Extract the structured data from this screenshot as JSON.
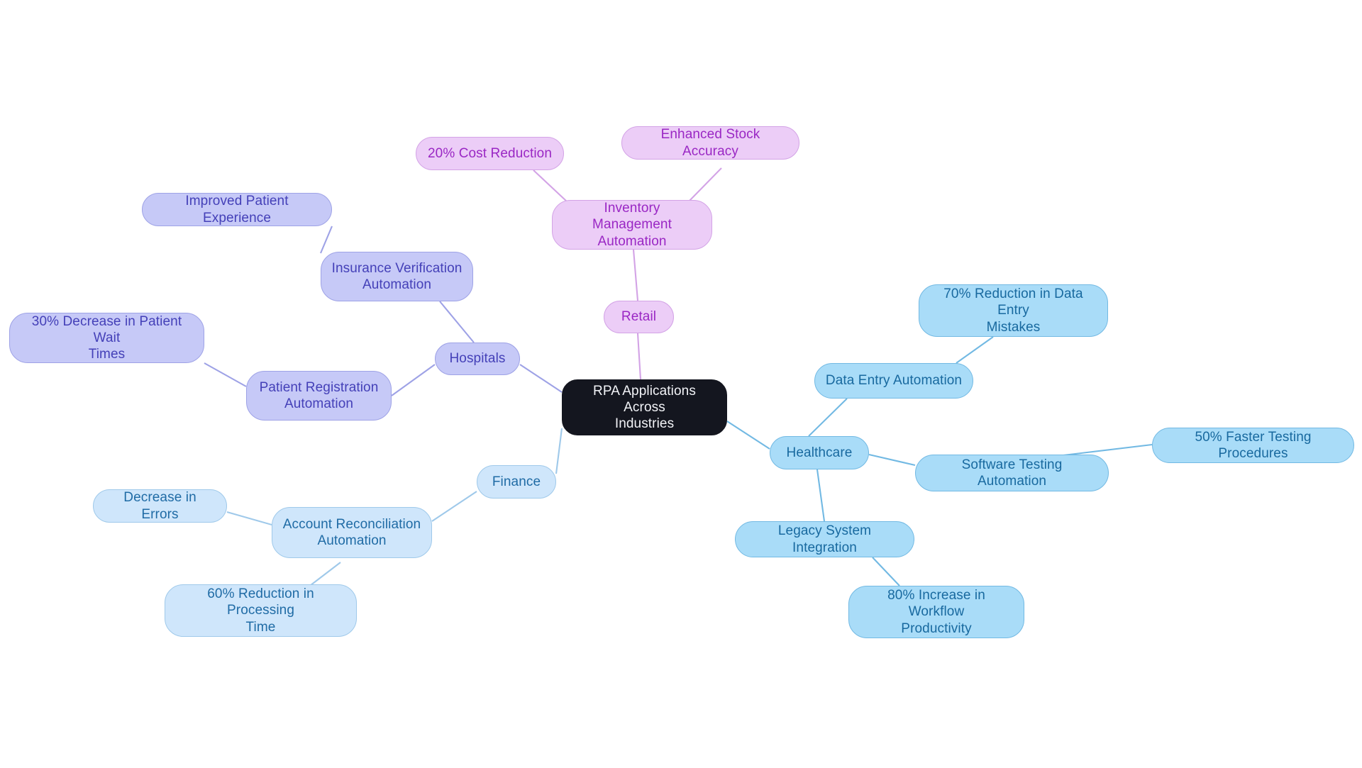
{
  "diagram": {
    "title": "RPA Applications Across Industries",
    "type": "mind-map",
    "background_color": "#ffffff"
  },
  "palette": {
    "root_fill": "#14161f",
    "root_text": "#f2f3f7",
    "lavender_fill": "#c6c9f7",
    "lavender_stroke": "#9ea2e6",
    "lavender_text": "#4440b8",
    "pink_fill": "#eccdf7",
    "pink_stroke": "#d3a3e6",
    "pink_text": "#9a27c4",
    "sky_fill": "#a9dcf8",
    "sky_stroke": "#72b9e3",
    "sky_text": "#18699f",
    "pale_fill": "#cfe6fb",
    "pale_stroke": "#9fc9ea",
    "pale_text": "#1f6ba5"
  },
  "nodes": {
    "root": {
      "label": "RPA Applications Across\nIndustries"
    },
    "hospitals": {
      "label": "Hospitals"
    },
    "insurance_verification": {
      "label": "Insurance Verification\nAutomation"
    },
    "improved_patient_experience": {
      "label": "Improved Patient Experience"
    },
    "patient_registration": {
      "label": "Patient Registration\nAutomation"
    },
    "patient_wait_times": {
      "label": "30% Decrease in Patient Wait\nTimes"
    },
    "retail": {
      "label": "Retail"
    },
    "inventory_management": {
      "label": "Inventory Management\nAutomation"
    },
    "cost_reduction": {
      "label": "20% Cost Reduction"
    },
    "stock_accuracy": {
      "label": "Enhanced Stock Accuracy"
    },
    "healthcare": {
      "label": "Healthcare"
    },
    "data_entry_automation": {
      "label": "Data Entry Automation"
    },
    "data_entry_mistakes": {
      "label": "70% Reduction in Data Entry\nMistakes"
    },
    "software_testing_automation": {
      "label": "Software Testing Automation"
    },
    "faster_testing": {
      "label": "50% Faster Testing Procedures"
    },
    "legacy_system_integration": {
      "label": "Legacy System Integration"
    },
    "workflow_productivity": {
      "label": "80% Increase in Workflow\nProductivity"
    },
    "finance": {
      "label": "Finance"
    },
    "account_reconciliation": {
      "label": "Account Reconciliation\nAutomation"
    },
    "decrease_in_errors": {
      "label": "Decrease in Errors"
    },
    "processing_time": {
      "label": "60% Reduction in Processing\nTime"
    }
  },
  "chart_data": {
    "type": "diagram",
    "title": "RPA Applications Across Industries",
    "root": "RPA Applications Across Industries",
    "branches": [
      {
        "name": "Hospitals",
        "color": "#c6c9f7",
        "children": [
          {
            "name": "Insurance Verification Automation",
            "children": [
              {
                "name": "Improved Patient Experience"
              }
            ]
          },
          {
            "name": "Patient Registration Automation",
            "children": [
              {
                "name": "30% Decrease in Patient Wait Times"
              }
            ]
          }
        ]
      },
      {
        "name": "Retail",
        "color": "#eccdf7",
        "children": [
          {
            "name": "Inventory Management Automation",
            "children": [
              {
                "name": "20% Cost Reduction"
              },
              {
                "name": "Enhanced Stock Accuracy"
              }
            ]
          }
        ]
      },
      {
        "name": "Healthcare",
        "color": "#a9dcf8",
        "children": [
          {
            "name": "Data Entry Automation",
            "children": [
              {
                "name": "70% Reduction in Data Entry Mistakes"
              }
            ]
          },
          {
            "name": "Software Testing Automation",
            "children": [
              {
                "name": "50% Faster Testing Procedures"
              }
            ]
          },
          {
            "name": "Legacy System Integration",
            "children": [
              {
                "name": "80% Increase in Workflow Productivity"
              }
            ]
          }
        ]
      },
      {
        "name": "Finance",
        "color": "#cfe6fb",
        "children": [
          {
            "name": "Account Reconciliation Automation",
            "children": [
              {
                "name": "Decrease in Errors"
              },
              {
                "name": "60% Reduction in Processing Time"
              }
            ]
          }
        ]
      }
    ]
  }
}
